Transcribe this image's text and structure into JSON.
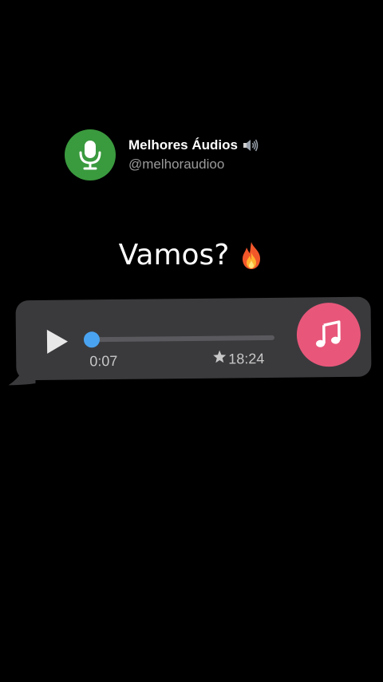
{
  "profile": {
    "name": "Melhores Áudios",
    "handle": "@melhoraudioo",
    "avatar_icon": "microphone-icon",
    "name_icon": "speaker-icon",
    "avatar_color": "#3a9a3e"
  },
  "caption": {
    "text": "Vamos?",
    "emoji_icon": "fire-icon"
  },
  "audio_message": {
    "play_icon": "play-icon",
    "elapsed": "0:07",
    "duration": "18:24",
    "duration_icon": "star-icon",
    "progress": 0.0,
    "music_icon": "music-note-icon",
    "bubble_color": "#3a3a3d",
    "progress_color": "#4aa3f0",
    "music_button_color": "#e8577a"
  }
}
